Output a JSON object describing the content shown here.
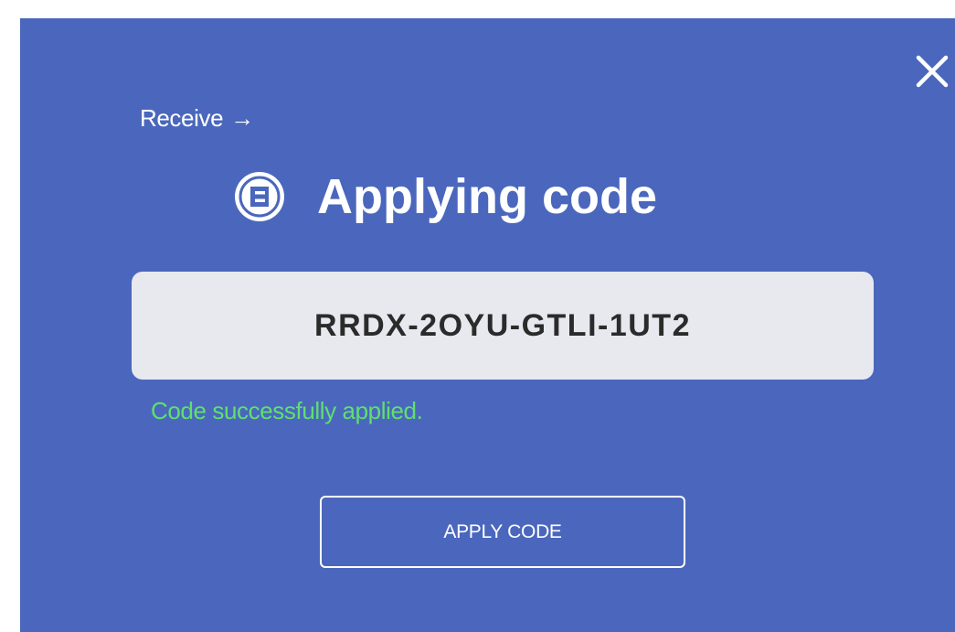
{
  "dialog": {
    "close_icon": "close-icon",
    "receive_link": {
      "label": "Receive",
      "arrow": "→"
    },
    "brand_icon": "coin-logo-icon",
    "title": "Applying code",
    "code_field": {
      "value": "RRDX-2OYU-GTLI-1UT2"
    },
    "status_message": "Code successfully applied.",
    "apply_button_label": "APPLY CODE"
  },
  "colors": {
    "background": "#4a67bd",
    "field_background": "#e8e8ef",
    "success_text": "#5fe06e",
    "text": "#ffffff"
  }
}
